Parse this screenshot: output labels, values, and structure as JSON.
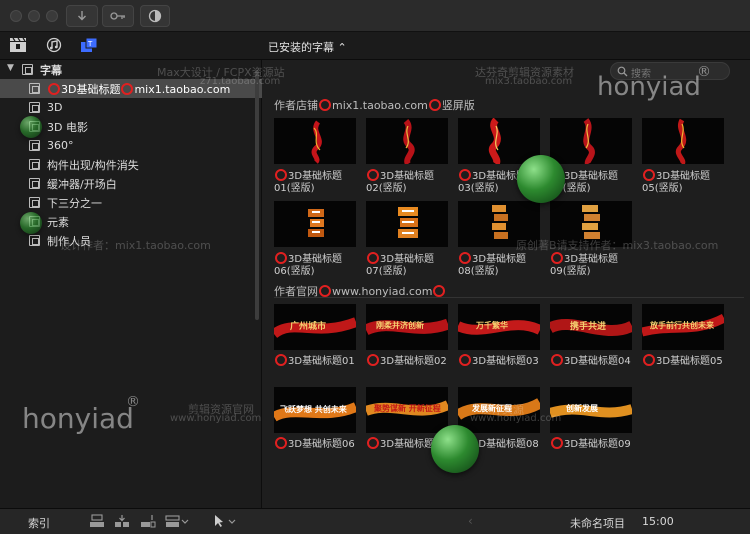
{
  "toolbar": {},
  "browser": {
    "installed_label": "已安装的字幕 ⌃"
  },
  "sidebar": {
    "items": [
      {
        "label": "字幕",
        "type": "group"
      },
      {
        "label": "3D基础标题",
        "suffix": "mix1.taobao.com",
        "selected": true
      },
      {
        "label": "3D"
      },
      {
        "label": "3D 电影"
      },
      {
        "label": "360°"
      },
      {
        "label": "构件出现/构件消失"
      },
      {
        "label": "缓冲器/开场白"
      },
      {
        "label": "下三分之一"
      },
      {
        "label": "元素"
      },
      {
        "label": "制作人员"
      }
    ]
  },
  "search": {
    "placeholder": "搜索"
  },
  "sections": [
    {
      "title_prefix": "作者店铺",
      "title_link": "mix1.taobao.com",
      "title_suffix": "竖屏版",
      "items": [
        {
          "line1": "3D基础标题",
          "line2": "01(竖版)"
        },
        {
          "line1": "3D基础标题",
          "line2": "02(竖版)"
        },
        {
          "line1": "3D基础标题",
          "line2": "03(竖版)"
        },
        {
          "line1": "3D基础标题",
          "line2": "04(竖版)"
        },
        {
          "line1": "3D基础标题",
          "line2": "05(竖版)"
        },
        {
          "line1": "3D基础标题",
          "line2": "06(竖版)"
        },
        {
          "line1": "3D基础标题",
          "line2": "07(竖版)"
        },
        {
          "line1": "3D基础标题",
          "line2": "08(竖版)"
        },
        {
          "line1": "3D基础标题",
          "line2": "09(竖版)"
        }
      ]
    },
    {
      "title_prefix": "作者官网",
      "title_link": "www.honyiad.com",
      "title_suffix": "",
      "items": [
        {
          "line1": "3D基础标题01",
          "thumb_text": "广州城市"
        },
        {
          "line1": "3D基础标题02",
          "thumb_text": "刚柔并济创新"
        },
        {
          "line1": "3D基础标题03",
          "thumb_text": "万千繁华"
        },
        {
          "line1": "3D基础标题04",
          "thumb_text": "携手共进"
        },
        {
          "line1": "3D基础标题05",
          "thumb_text": "放手前行共创未来"
        },
        {
          "line1": "3D基础标题06",
          "thumb_text": "飞跃梦想 共创未来"
        },
        {
          "line1": "3D基础标题07",
          "thumb_text": "聚势谋新 开新征程"
        },
        {
          "line1": "3D基础标题08",
          "thumb_text": "发展新征程"
        },
        {
          "line1": "3D基础标题09",
          "thumb_text": "创新发展"
        }
      ]
    }
  ],
  "bottombar": {
    "index_label": "索引",
    "project_name": "未命名项目",
    "timecode": "15:00"
  },
  "watermarks": {
    "wm1": "Max大设计 / FCPX资源站",
    "wm2": "z71.taobao.com",
    "wm3": "达芬奇剪辑资源素材",
    "wm4": "mix3.taobao.com",
    "wm5": "设计作者：mix1.taobao.com",
    "wm6": "原创著B请支持作者：mix3.taobao.com",
    "wm7": "剪辑资源官网",
    "wm8": "www.honyiad.com",
    "wm9": "设计资源",
    "wm10": "www.honyiad.com",
    "logo_text": "honyiad",
    "logo_mark": "®"
  },
  "colors": {
    "accent_red": "#e02020",
    "selected_row": "#4a4a4a",
    "active_icon": "#3d6cff"
  }
}
